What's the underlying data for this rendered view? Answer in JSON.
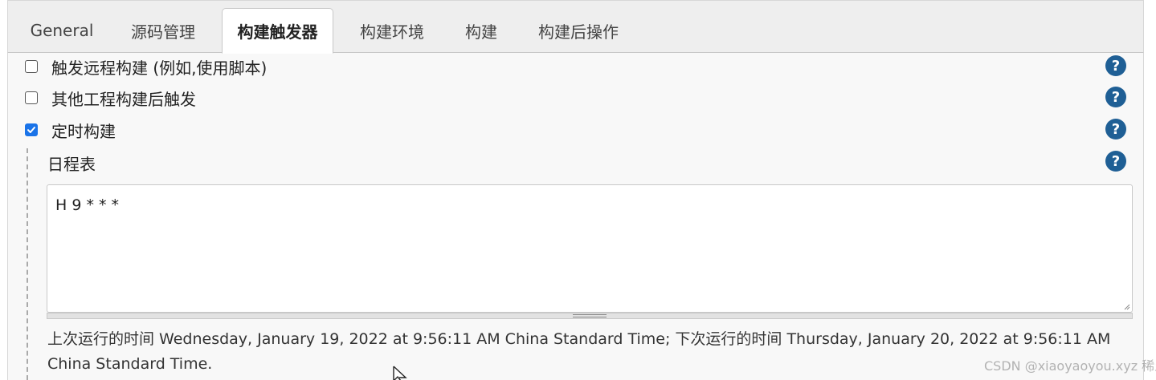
{
  "tabs": [
    {
      "label": "General",
      "active": false
    },
    {
      "label": "源码管理",
      "active": false
    },
    {
      "label": "构建触发器",
      "active": true
    },
    {
      "label": "构建环境",
      "active": false
    },
    {
      "label": "构建",
      "active": false
    },
    {
      "label": "构建后操作",
      "active": false
    }
  ],
  "triggers": [
    {
      "label": "触发远程构建 (例如,使用脚本)",
      "checked": false
    },
    {
      "label": "其他工程构建后触发",
      "checked": false
    },
    {
      "label": "定时构建",
      "checked": true
    }
  ],
  "schedule": {
    "label": "日程表",
    "value": "H 9 * * *",
    "info": "上次运行的时间 Wednesday, January 19, 2022 at 9:56:11 AM China Standard Time; 下次运行的时间 Thursday, January 20, 2022 at 9:56:11 AM China Standard Time."
  },
  "help_icon": "?",
  "watermark": "CSDN @xiaoyaoyou.xyz 稀土掘金技术社区",
  "colors": {
    "accent": "#1a73e8",
    "help": "#1f5f95"
  }
}
